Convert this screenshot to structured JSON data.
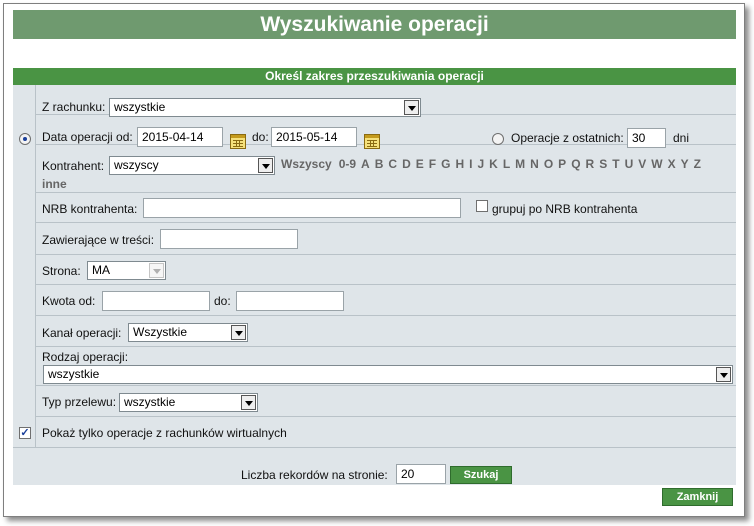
{
  "window": {
    "title": "Wyszukiwanie operacji"
  },
  "section": {
    "header": "Określ zakres przeszukiwania operacji"
  },
  "account": {
    "label": "Z rachunku:",
    "value": "wszystkie"
  },
  "date_range": {
    "label_from": "Data operacji od:",
    "from_value": "2015-04-14",
    "label_to": "do:",
    "to_value": "2015-05-14"
  },
  "recent": {
    "label": "Operacje z ostatnich:",
    "value": "30",
    "unit": "dni"
  },
  "contractor": {
    "label": "Kontrahent:",
    "value": "wszyscy",
    "letters": [
      "Wszyscy",
      "0-9",
      "A",
      "B",
      "C",
      "D",
      "E",
      "F",
      "G",
      "H",
      "I",
      "J",
      "K",
      "L",
      "M",
      "N",
      "O",
      "P",
      "Q",
      "R",
      "S",
      "T",
      "U",
      "V",
      "W",
      "X",
      "Y",
      "Z"
    ],
    "other": "inne"
  },
  "nrb": {
    "label": "NRB kontrahenta:",
    "value": "",
    "group_label": "grupuj po NRB kontrahenta"
  },
  "contains": {
    "label": "Zawierające w treści:",
    "value": ""
  },
  "side": {
    "label": "Strona:",
    "value": "MA"
  },
  "amount": {
    "label_from": "Kwota od:",
    "from_value": "",
    "label_to": "do:",
    "to_value": ""
  },
  "channel": {
    "label": "Kanał operacji:",
    "value": "Wszystkie"
  },
  "op_type": {
    "label": "Rodzaj operacji:",
    "value": "wszystkie"
  },
  "transfer_type": {
    "label": "Typ przelewu:",
    "value": "wszystkie"
  },
  "virtual": {
    "label": "Pokaż tylko operacje z rachunków wirtualnych"
  },
  "footer": {
    "records_label": "Liczba rekordów na stronie:",
    "records_value": "20",
    "search_button": "Szukaj",
    "close_button": "Zamknij"
  },
  "colors": {
    "title_bg": "#6f9a6f",
    "header_bg": "#4a9444",
    "form_bg": "#dfe5e9",
    "button_bg": "#4a9444"
  }
}
